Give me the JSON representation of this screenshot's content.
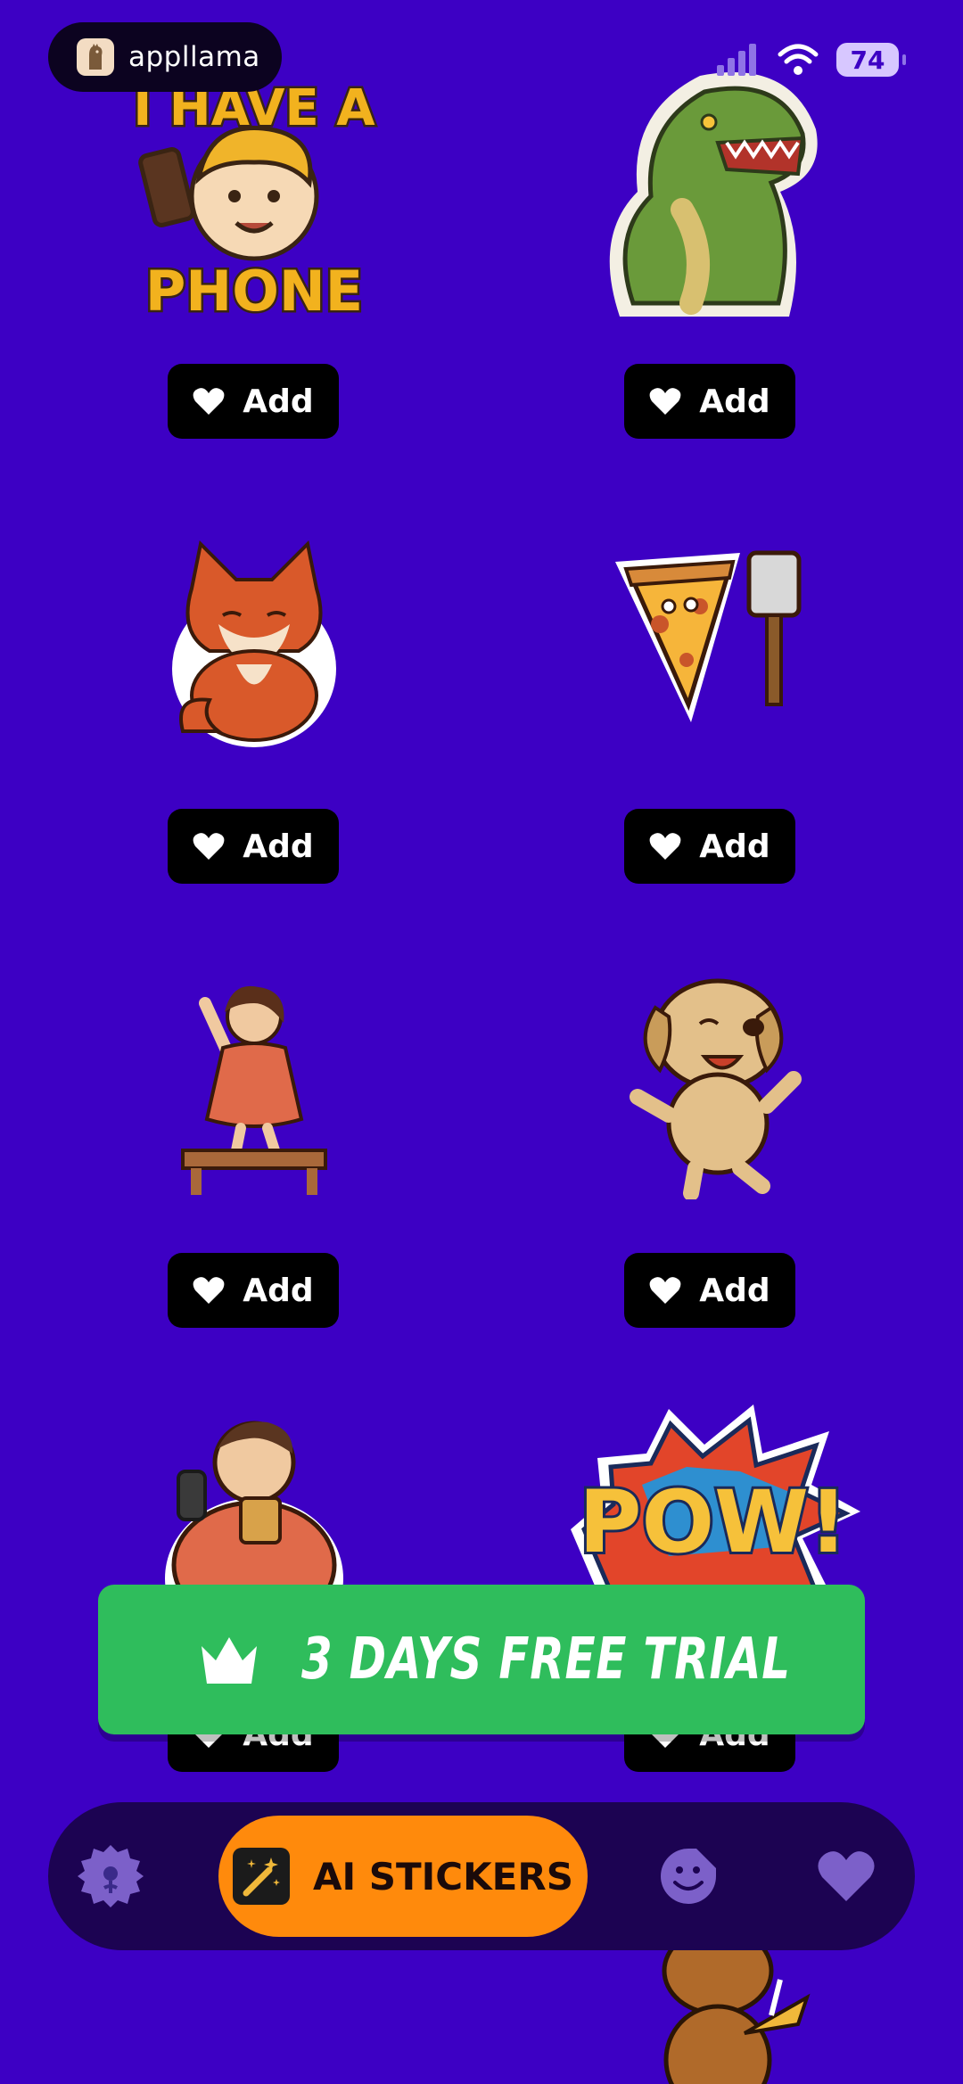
{
  "status_bar": {
    "app_name": "appllama",
    "battery": "74"
  },
  "stickers": [
    {
      "name": "i-have-a-phone",
      "caption_top": "I HAVE A",
      "caption_bottom": "PHONE",
      "add_label": "Add"
    },
    {
      "name": "t-rex",
      "add_label": "Add"
    },
    {
      "name": "fox",
      "add_label": "Add"
    },
    {
      "name": "pizza-slice",
      "add_label": "Add"
    },
    {
      "name": "woman-dancing-on-table",
      "add_label": "Add"
    },
    {
      "name": "dancing-dog",
      "add_label": "Add"
    },
    {
      "name": "man-eating-noodles",
      "add_label": "Add"
    },
    {
      "name": "pow",
      "caption": "POW!",
      "add_label": "Add"
    }
  ],
  "trial_banner": {
    "label": "3 DAYS FREE TRIAL"
  },
  "bottom_nav": {
    "active_label": "AI STICKERS",
    "items": [
      "home",
      "ai-stickers",
      "emoji",
      "favorites"
    ]
  },
  "colors": {
    "background": "#3d00c4",
    "trial_green": "#2fbd5c",
    "nav_active": "#ff8a0c",
    "nav_bg": "#1c0352"
  }
}
